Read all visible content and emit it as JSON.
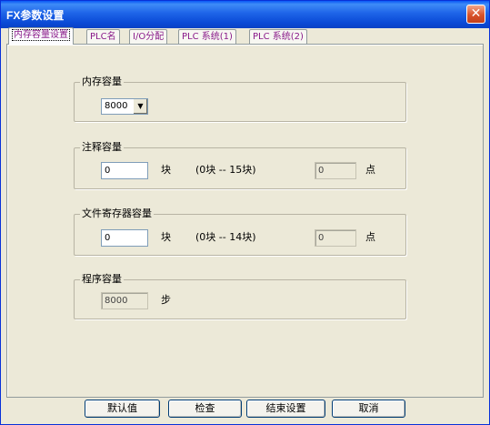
{
  "window": {
    "title": "FX参数设置",
    "close_glyph": "✕"
  },
  "tabs": [
    {
      "label": "内存容量设置",
      "active": true
    },
    {
      "label": "PLC名"
    },
    {
      "label": "I/O分配"
    },
    {
      "label": "PLC 系统(1)"
    },
    {
      "label": "PLC 系统(2)"
    }
  ],
  "memory_capacity": {
    "legend": "内存容量",
    "selected": "8000",
    "arrow": "▼"
  },
  "comment_capacity": {
    "legend": "注释容量",
    "value": "0",
    "unit": "块",
    "range": "(0块 -- 15块)",
    "points_value": "0",
    "points_unit": "点"
  },
  "file_register_capacity": {
    "legend": "文件寄存器容量",
    "value": "0",
    "unit": "块",
    "range": "(0块 -- 14块)",
    "points_value": "0",
    "points_unit": "点"
  },
  "program_capacity": {
    "legend": "程序容量",
    "value": "8000",
    "unit": "步"
  },
  "buttons": {
    "default": "默认值",
    "check": "检查",
    "finish": "结束设置",
    "cancel": "取消"
  }
}
